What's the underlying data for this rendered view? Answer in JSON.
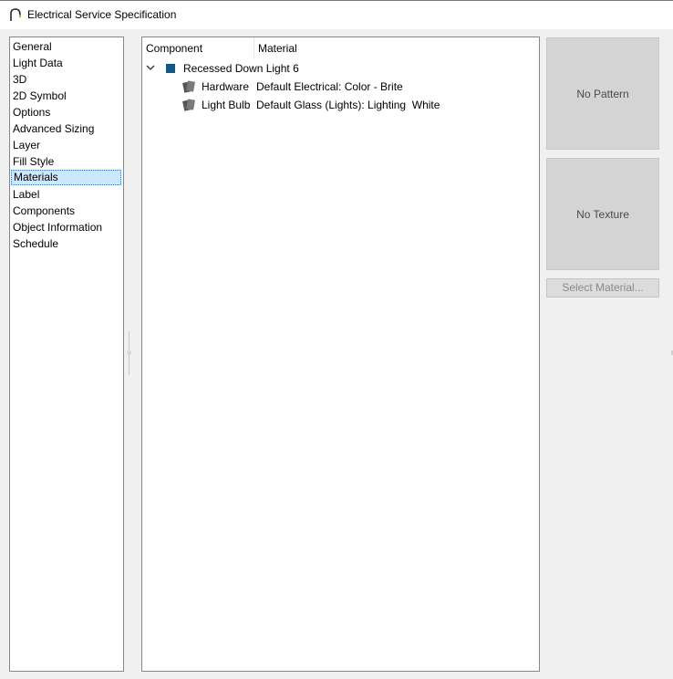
{
  "window": {
    "title": "Electrical Service Specification"
  },
  "sidebar": {
    "items": [
      {
        "label": "General"
      },
      {
        "label": "Light Data"
      },
      {
        "label": "3D"
      },
      {
        "label": "2D Symbol"
      },
      {
        "label": "Options"
      },
      {
        "label": "Advanced Sizing"
      },
      {
        "label": "Layer"
      },
      {
        "label": "Fill Style"
      },
      {
        "label": "Materials",
        "selected": true
      },
      {
        "label": "Label"
      },
      {
        "label": "Components"
      },
      {
        "label": "Object Information"
      },
      {
        "label": "Schedule"
      }
    ]
  },
  "table": {
    "columns": [
      "Component",
      "Material"
    ],
    "group": {
      "label": "Recessed Down Light 6",
      "expanded": true,
      "swatch_color": "#0f5a86",
      "icon": "chevron-down-icon"
    },
    "rows": [
      {
        "component": "Hardware",
        "material": "Default Electrical: Color - Brite",
        "icon": "material-swatch-icon"
      },
      {
        "component": "Light Bulb",
        "material": "Default Glass (Lights): Lighting  White",
        "icon": "material-swatch-icon"
      }
    ]
  },
  "preview": {
    "pattern_label": "No Pattern",
    "texture_label": "No Texture",
    "select_button_label": "Select Material..."
  }
}
